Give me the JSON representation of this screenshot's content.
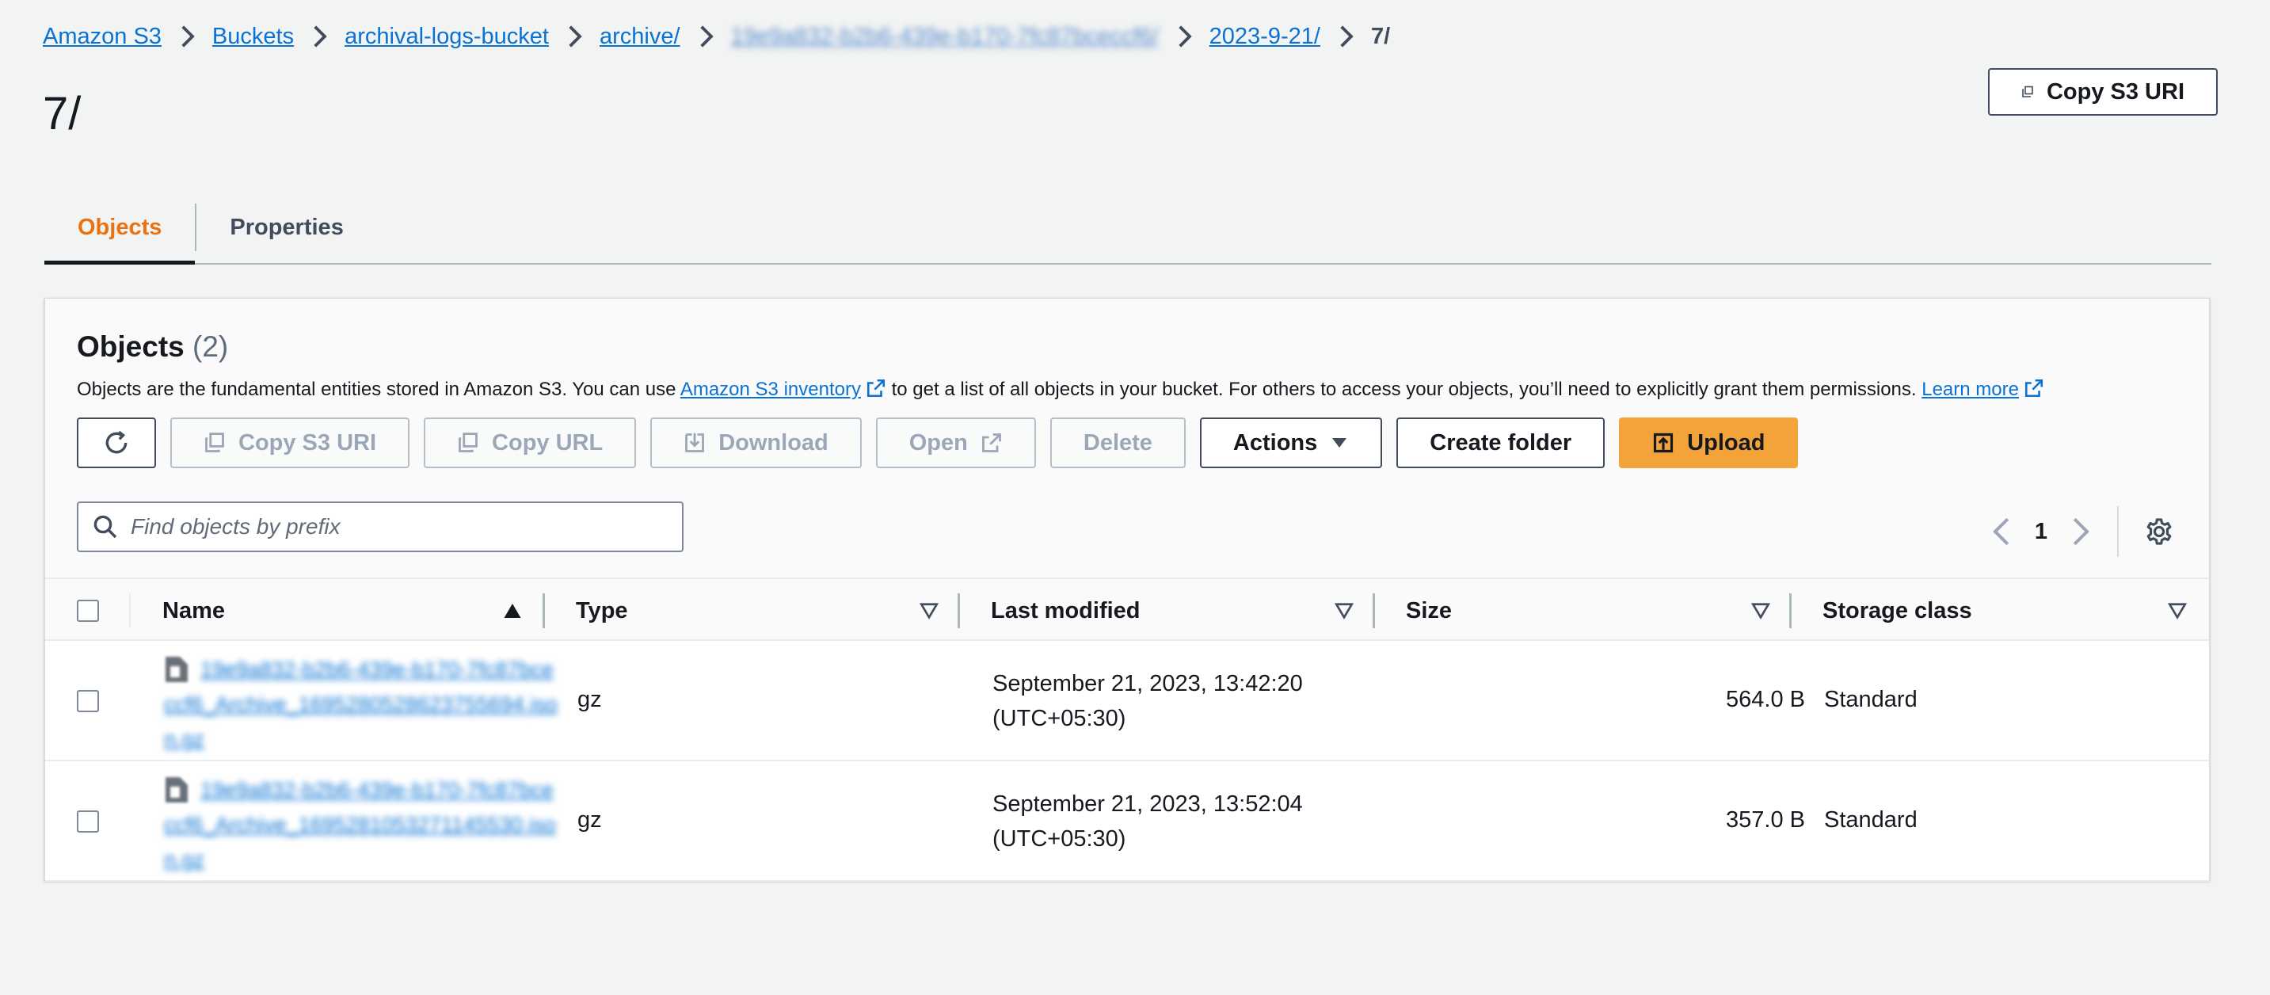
{
  "breadcrumb": {
    "items": [
      "Amazon S3",
      "Buckets",
      "archival-logs-bucket",
      "archive/",
      "19e9a832-b2b6-439e-b170-7fc87bceccf6/",
      "2023-9-21/"
    ],
    "current": "7/"
  },
  "page": {
    "title": "7/",
    "copy_uri_label": "Copy S3 URI"
  },
  "tabs": [
    {
      "label": "Objects"
    },
    {
      "label": "Properties"
    }
  ],
  "objects": {
    "heading": "Objects",
    "count": "(2)",
    "desc_1": "Objects are the fundamental entities stored in Amazon S3. You can use ",
    "inventory_link": "Amazon S3 inventory",
    "desc_2": " to get a list of all objects in your bucket. For others to access your objects, you’ll need to explicitly grant them permissions. ",
    "learn_more": "Learn more"
  },
  "toolbar": {
    "copy_s3_uri": "Copy S3 URI",
    "copy_url": "Copy URL",
    "download": "Download",
    "open": "Open",
    "delete": "Delete",
    "actions": "Actions",
    "create_folder": "Create folder",
    "upload": "Upload"
  },
  "search": {
    "placeholder": "Find objects by prefix"
  },
  "pagination": {
    "page": "1"
  },
  "table": {
    "headers": {
      "name": "Name",
      "type": "Type",
      "last_modified": "Last modified",
      "size": "Size",
      "storage_class": "Storage class"
    },
    "rows": [
      {
        "name": "19e9a832-b2b6-439e-b170-7fc87bceccf6_Archive_1695280528623755694.json.gz",
        "type": "gz",
        "modified_date": "September 21, 2023, 13:42:20",
        "modified_tz": "(UTC+05:30)",
        "size": "564.0 B",
        "storage_class": "Standard"
      },
      {
        "name": "19e9a832-b2b6-439e-b170-7fc87bceccf6_Archive_1695281053271145530.json.gz",
        "type": "gz",
        "modified_date": "September 21, 2023, 13:52:04",
        "modified_tz": "(UTC+05:30)",
        "size": "357.0 B",
        "storage_class": "Standard"
      }
    ]
  },
  "colors": {
    "link": "#0972d3",
    "active_tab": "#ec7211",
    "primary": "#f2a33a"
  }
}
